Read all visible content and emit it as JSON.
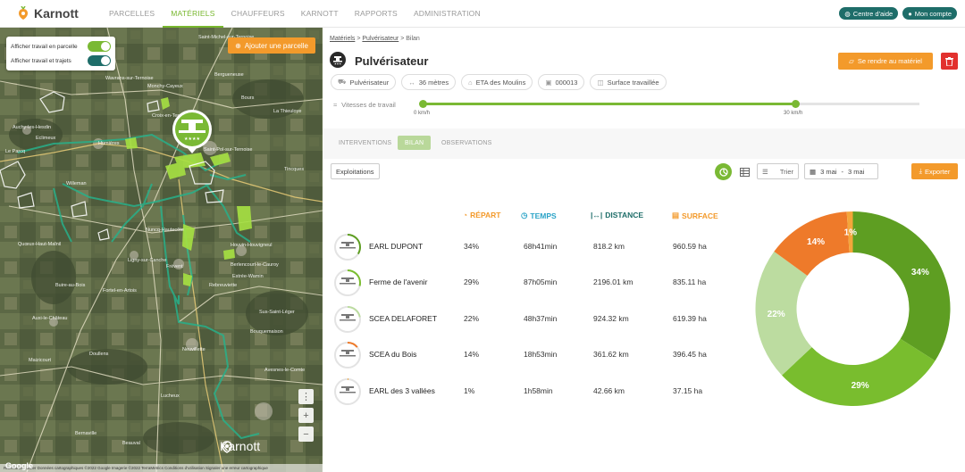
{
  "brand": {
    "name": "Karnott",
    "color": "#f39a2b",
    "green": "#7ab934",
    "teal": "#1e6d69"
  },
  "nav": {
    "items": [
      {
        "label": "PARCELLES",
        "active": false
      },
      {
        "label": "MATÉRIELS",
        "active": true
      },
      {
        "label": "CHAUFFEURS",
        "active": false
      },
      {
        "label": "KARNOTT",
        "active": false
      },
      {
        "label": "RAPPORTS",
        "active": false
      },
      {
        "label": "ADMINISTRATION",
        "active": false
      }
    ],
    "help_label": "Centre d'aide",
    "account_label": "Mon compte"
  },
  "map": {
    "toggles": [
      {
        "label": "Afficher travail en parcelle",
        "on": true,
        "color": "#7ab934"
      },
      {
        "label": "Afficher travail et trajets",
        "on": true,
        "color": "#1e6d69"
      }
    ],
    "add_parcel_label": "Ajouter une parcelle",
    "brand_label": "Karnott",
    "google_label": "Google",
    "attribution": "Raccourcis clavier   Données cartographiques ©2022 Google Imagerie ©2022 TerraMetrics   Conditions d'utilisation   Signaler une erreur cartographique",
    "places": [
      {
        "name": "Saint-Michel-sur-Ternoise"
      },
      {
        "name": "Wavrans-sur-Ternoise"
      },
      {
        "name": "Auchy-les-Hesdin"
      },
      {
        "name": "Humières"
      },
      {
        "name": "Le Parcq"
      },
      {
        "name": "Eclimeux"
      },
      {
        "name": "Croix-en-Ternois"
      },
      {
        "name": "Saint-Pol-sur-Ternoise"
      },
      {
        "name": "Willeman"
      },
      {
        "name": "Nuncq-Hautecôte"
      },
      {
        "name": "Frévent"
      },
      {
        "name": "Houvin-Houvigneul"
      },
      {
        "name": "Rebreuviette"
      },
      {
        "name": "Monchy-Cayeux"
      },
      {
        "name": "Bergueneuse"
      },
      {
        "name": "Bours"
      },
      {
        "name": "La Thieuloye"
      },
      {
        "name": "Tincques"
      },
      {
        "name": "Fortel-en-Artois"
      },
      {
        "name": "Buire-au-Bois"
      },
      {
        "name": "Auxi-le-Château"
      },
      {
        "name": "Neuvillette"
      },
      {
        "name": "Doullens"
      },
      {
        "name": "Lucheux"
      },
      {
        "name": "Bernaville"
      },
      {
        "name": "Beauval"
      },
      {
        "name": "Quœux-Haut-Maînil"
      },
      {
        "name": "Maizicourt"
      },
      {
        "name": "Estrée-Wamin"
      },
      {
        "name": "Sus-Saint-Léger"
      },
      {
        "name": "Bouquemaison"
      },
      {
        "name": "Ligny-sur-Canche"
      },
      {
        "name": "Berlencourt-le-Cauroy"
      },
      {
        "name": "Avesnes-le-Comte"
      }
    ]
  },
  "detail": {
    "breadcrumb": {
      "root": "Matériels",
      "parent": "Pulvérisateur",
      "current": "Bilan",
      "sep": " > "
    },
    "title": "Pulvérisateur",
    "goto_label": "Se rendre au matériel",
    "chips": [
      {
        "icon": "tractor-icon",
        "label": "Pulvérisateur"
      },
      {
        "icon": "width-icon",
        "label": "36 mètres"
      },
      {
        "icon": "home-icon",
        "label": "ETA des Moulins"
      },
      {
        "icon": "chip-icon",
        "label": "000013"
      },
      {
        "icon": "area-icon",
        "label": "Surface travaillée"
      }
    ],
    "speed": {
      "label": "Vitesses de travail",
      "min_label": "0 km/h",
      "max_label": "30 km/h",
      "min": 0,
      "max": 30
    },
    "tabs": [
      {
        "label": "INTERVENTIONS",
        "active": false
      },
      {
        "label": "BILAN",
        "active": true
      },
      {
        "label": "OBSERVATIONS",
        "active": false
      }
    ],
    "toolbar": {
      "exploitations_label": "Exploitations",
      "sort_label": "Trier",
      "date_from": "3 mai",
      "date_sep": "-",
      "date_to": "3 mai",
      "export_label": "Exporter"
    },
    "columns": {
      "repart": "RÉPART",
      "temps": "TEMPS",
      "distance": "DISTANCE",
      "surface": "SURFACE"
    },
    "rows": [
      {
        "name": "EARL DUPONT",
        "repart": "34%",
        "temps": "68h41min",
        "distance": "818.2 km",
        "surface": "960.59 ha",
        "pct": 34,
        "color": "#5e9e22"
      },
      {
        "name": "Ferme de l'avenir",
        "repart": "29%",
        "temps": "87h05min",
        "distance": "2196.01 km",
        "surface": "835.11 ha",
        "pct": 29,
        "color": "#79bd2e"
      },
      {
        "name": "SCEA DELAFORET",
        "repart": "22%",
        "temps": "48h37min",
        "distance": "924.32 km",
        "surface": "619.39 ha",
        "pct": 22,
        "color": "#bcdca0"
      },
      {
        "name": "SCEA du Bois",
        "repart": "14%",
        "temps": "18h53min",
        "distance": "361.62 km",
        "surface": "396.45 ha",
        "pct": 14,
        "color": "#ee7a2a"
      },
      {
        "name": "EARL des 3 vallées",
        "repart": "1%",
        "temps": "1h58min",
        "distance": "42.66 km",
        "surface": "37.15 ha",
        "pct": 1,
        "color": "#f4a63b"
      }
    ]
  },
  "chart_data": {
    "type": "pie",
    "categories": [
      "EARL DUPONT",
      "Ferme de l'avenir",
      "SCEA DELAFORET",
      "SCEA du Bois",
      "EARL des 3 vallées"
    ],
    "values": [
      34,
      29,
      22,
      14,
      1
    ],
    "labels": [
      "34%",
      "29%",
      "22%",
      "14%",
      "1%"
    ],
    "colors": [
      "#5e9e22",
      "#79bd2e",
      "#bcdca0",
      "#ee7a2a",
      "#f4a63b"
    ],
    "donut": true
  }
}
